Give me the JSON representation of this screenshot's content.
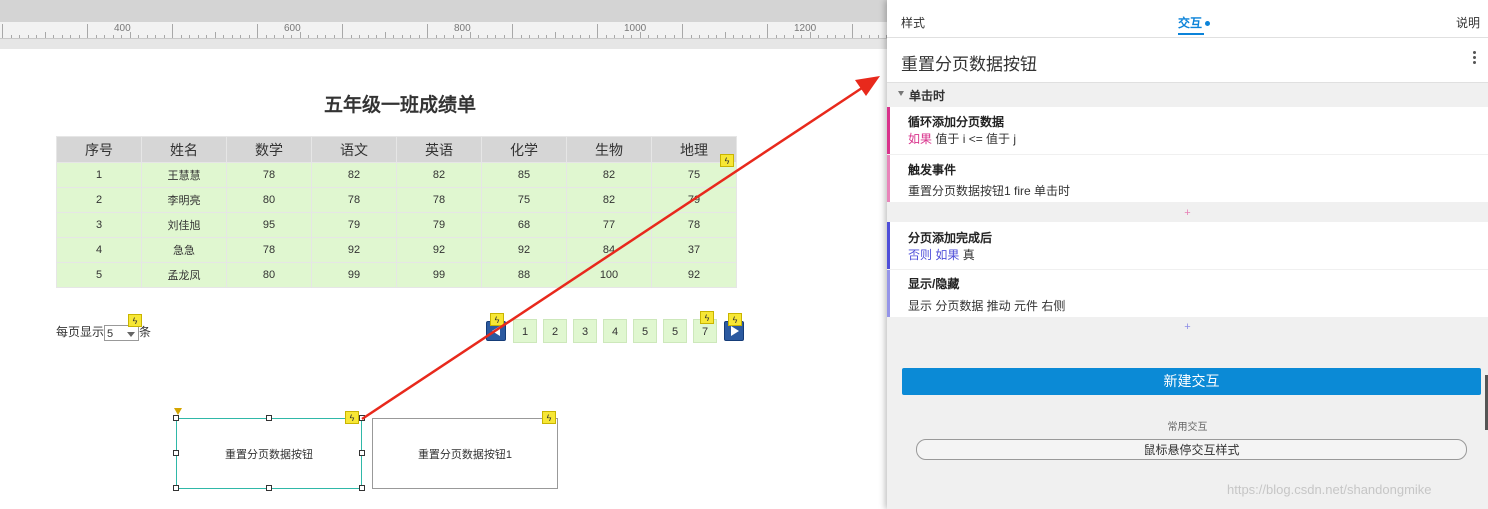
{
  "canvas": {
    "ruler_labels": [
      "400",
      "600",
      "800",
      "1000",
      "1200"
    ],
    "page_title": "五年级一班成绩单",
    "table": {
      "headers": [
        "序号",
        "姓名",
        "数学",
        "语文",
        "英语",
        "化学",
        "生物",
        "地理"
      ],
      "rows": [
        [
          "1",
          "王慧慧",
          "78",
          "82",
          "82",
          "85",
          "82",
          "75"
        ],
        [
          "2",
          "李明亮",
          "80",
          "78",
          "78",
          "75",
          "82",
          "79"
        ],
        [
          "3",
          "刘佳旭",
          "95",
          "79",
          "79",
          "68",
          "77",
          "78"
        ],
        [
          "4",
          "急急",
          "78",
          "92",
          "92",
          "92",
          "84",
          "37"
        ],
        [
          "5",
          "孟龙凤",
          "80",
          "99",
          "99",
          "88",
          "100",
          "92"
        ]
      ]
    },
    "per_page": {
      "prefix": "每页显示",
      "value": "5",
      "suffix": "条"
    },
    "pager": {
      "pages": [
        "1",
        "2",
        "3",
        "4",
        "5",
        "5",
        "7"
      ]
    },
    "button_selected_label": "重置分页数据按钮",
    "button_other_label": "重置分页数据按钮1",
    "bolt_glyph": "ϟ"
  },
  "panel": {
    "tabs": {
      "style": "样式",
      "interaction": "交互",
      "notes": "说明"
    },
    "widget_name": "重置分页数据按钮",
    "event_header": "单击时",
    "cases": [
      {
        "title": "循环添加分页数据",
        "cond_kw": "如果",
        "cond_text": "值于 i <= 值于 j",
        "bar_color": "#d9338c"
      },
      {
        "title": "触发事件",
        "cond_kw": "",
        "cond_text": "重置分页数据按钮1 fire 单击时",
        "bar_color": "#d9338c"
      },
      {
        "title": "分页添加完成后",
        "cond_kw": "否则 如果",
        "cond_text": "真",
        "bar_color": "#4f4fd9"
      },
      {
        "title": "显示/隐藏",
        "cond_kw": "",
        "cond_text": "显示 分页数据 推动 元件 右侧",
        "bar_color": "#4f4fd9"
      }
    ],
    "add_symbol": "+",
    "new_interaction_label": "新建交互",
    "common_label": "常用交互",
    "hover_style_label": "鼠标悬停交互样式"
  },
  "watermark": "https://blog.csdn.net/shandongmike",
  "colors": {
    "accent": "#0b83d9",
    "table_row": "#e0f7d0",
    "table_header": "#d6d6d6",
    "arrow": "#e8291c"
  }
}
